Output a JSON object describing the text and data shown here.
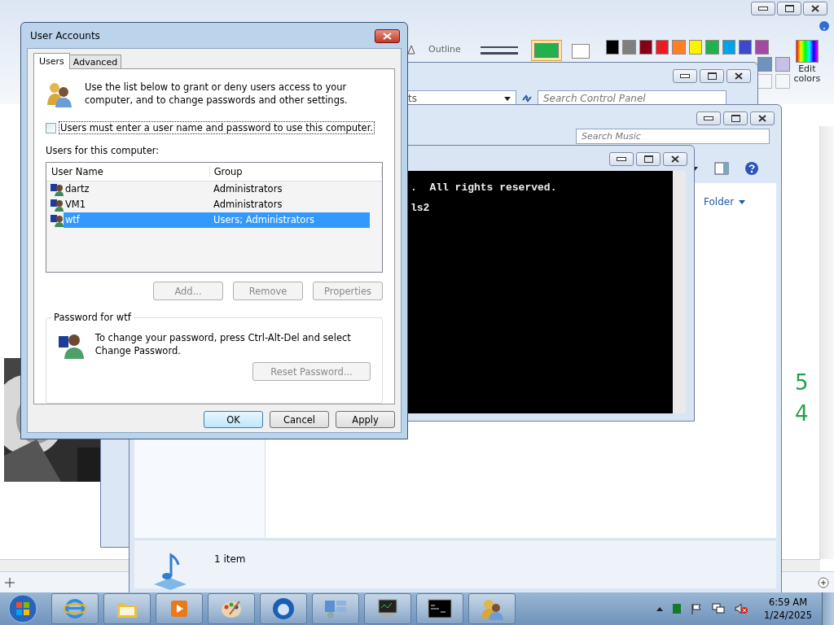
{
  "paint": {
    "outline_label": "Outline",
    "palette": [
      {
        "color": "#000000"
      },
      {
        "color": "#7f7f7f"
      },
      {
        "color": "#880015"
      },
      {
        "color": "#ed1c24"
      },
      {
        "color": "#ff7f27"
      },
      {
        "color": "#fff200"
      },
      {
        "color": "#22b14c"
      },
      {
        "color": "#00a2e8"
      },
      {
        "color": "#3f48cc"
      },
      {
        "color": "#a349a4"
      }
    ],
    "palette_row2": [
      {
        "color": "#7092be"
      },
      {
        "color": "#c8bfe7"
      }
    ],
    "color1": {
      "color": "#22b14c"
    },
    "color2": {
      "color": "#ffffff"
    },
    "edit_colors": "Edit colors",
    "canvas_numbers": [
      "5",
      "4"
    ]
  },
  "control_panel": {
    "address_text": "ts",
    "search": {
      "placeholder": "Search Control Panel"
    }
  },
  "music_window": {
    "search": {
      "placeholder": "Search Music"
    },
    "column_button": "Folder",
    "status": "1 item"
  },
  "console": {
    "lines": [
      ".  All rights reserved.",
      "ls2"
    ]
  },
  "dialog": {
    "title": "User Accounts",
    "tabs": [
      {
        "label": "Users",
        "selected": true
      },
      {
        "label": "Advanced",
        "selected": false
      }
    ],
    "intro": "Use the list below to grant or deny users access to your computer, and to change passwords and other settings.",
    "require_password": {
      "label": "Users must enter a user name and password to use this computer.",
      "checked": false
    },
    "list_label": "Users for this computer:",
    "columns": [
      "User Name",
      "Group"
    ],
    "rows": [
      {
        "name": "dartz",
        "group": "Administrators",
        "selected": false
      },
      {
        "name": "VM1",
        "group": "Administrators",
        "selected": false
      },
      {
        "name": "wtf",
        "group": "Users; Administrators",
        "selected": true
      }
    ],
    "list_buttons": [
      {
        "label": "Add...",
        "disabled": true
      },
      {
        "label": "Remove",
        "disabled": true
      },
      {
        "label": "Properties",
        "disabled": true
      }
    ],
    "password_group": {
      "title": "Password for wtf",
      "text": "To change your password, press Ctrl-Alt-Del and select Change Password.",
      "button": {
        "label": "Reset Password...",
        "disabled": true
      }
    },
    "buttons": [
      {
        "label": "OK",
        "default": true
      },
      {
        "label": "Cancel",
        "default": false
      },
      {
        "label": "Apply",
        "default": false
      }
    ]
  },
  "taskbar": {
    "apps": [
      {
        "kind": "ie"
      },
      {
        "kind": "folder"
      },
      {
        "kind": "media"
      },
      {
        "kind": "paint"
      },
      {
        "kind": "mail"
      },
      {
        "kind": "panel"
      },
      {
        "kind": "monitor"
      },
      {
        "kind": "console"
      },
      {
        "kind": "users"
      }
    ],
    "clock": {
      "time": "6:59 AM",
      "date": "1/24/2025"
    }
  }
}
